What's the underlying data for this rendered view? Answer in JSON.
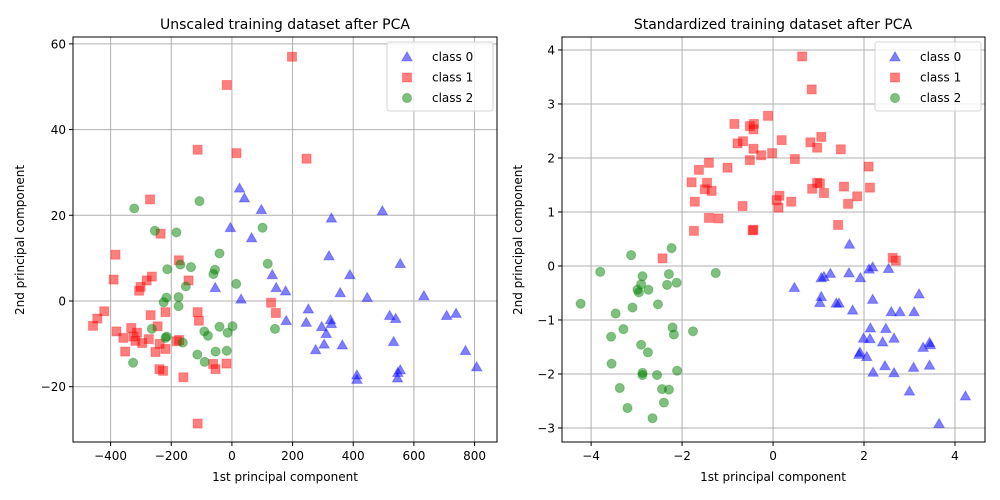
{
  "figure": {
    "legend_labels": [
      "class 0",
      "class 1",
      "class 2"
    ],
    "colors": {
      "class0": "#0000ff",
      "class1": "#ff0000",
      "class2": "#008000",
      "grid": "#b0b0b0"
    },
    "markers": {
      "class0": "triangle",
      "class1": "square",
      "class2": "circle"
    },
    "alpha": 0.5
  },
  "chart_data": [
    {
      "type": "scatter",
      "title": "Unscaled training dataset after PCA",
      "xlabel": "1st principal component",
      "ylabel": "2nd principal component",
      "xlim": [
        -524,
        874
      ],
      "ylim": [
        -32.9,
        61.6
      ],
      "xticks": [
        -400,
        -200,
        0,
        200,
        400,
        600,
        800
      ],
      "xtick_labels": [
        "−400",
        "−200",
        "0",
        "200",
        "400",
        "600",
        "800"
      ],
      "yticks": [
        -20,
        0,
        20,
        40,
        60
      ],
      "ytick_labels": [
        "−20",
        "0",
        "20",
        "40",
        "60"
      ],
      "grid": true,
      "legend": "top-right",
      "series": [
        {
          "name": "class 0",
          "points": [
            [
              25,
              26.3
            ],
            [
              41,
              24.0
            ],
            [
              97,
              21.3
            ],
            [
              -5,
              17.1
            ],
            [
              65,
              14.7
            ],
            [
              328,
              19.3
            ],
            [
              496,
              21.0
            ],
            [
              320,
              10.5
            ],
            [
              555,
              8.7
            ],
            [
              389,
              6.1
            ],
            [
              133,
              6.1
            ],
            [
              -55,
              3.1
            ],
            [
              146,
              3.1
            ],
            [
              177,
              2.3
            ],
            [
              30,
              0.4
            ],
            [
              357,
              1.9
            ],
            [
              446,
              0.8
            ],
            [
              633,
              1.2
            ],
            [
              252,
              -1.9
            ],
            [
              179,
              -4.6
            ],
            [
              245,
              -5.0
            ],
            [
              296,
              -6.0
            ],
            [
              325,
              -4.4
            ],
            [
              328,
              -5.3
            ],
            [
              311,
              -7.6
            ],
            [
              520,
              -3.4
            ],
            [
              540,
              -4.1
            ],
            [
              708,
              -3.4
            ],
            [
              739,
              -2.9
            ],
            [
              533,
              -9.5
            ],
            [
              276,
              -11.4
            ],
            [
              304,
              -10.1
            ],
            [
              364,
              -10.3
            ],
            [
              770,
              -11.6
            ],
            [
              807,
              -15.4
            ],
            [
              412,
              -17.3
            ],
            [
              412,
              -18.3
            ],
            [
              547,
              -16.7
            ],
            [
              555,
              -16.1
            ],
            [
              546,
              -18.0
            ]
          ]
        },
        {
          "name": "class 1",
          "points": [
            [
              198,
              57.0
            ],
            [
              -17,
              50.4
            ],
            [
              -113,
              35.3
            ],
            [
              15,
              34.5
            ],
            [
              246,
              33.2
            ],
            [
              -270,
              23.7
            ],
            [
              -235,
              15.7
            ],
            [
              -384,
              10.8
            ],
            [
              -175,
              9.5
            ],
            [
              -390,
              5.0
            ],
            [
              -264,
              5.7
            ],
            [
              -281,
              4.8
            ],
            [
              -143,
              4.8
            ],
            [
              -301,
              3.3
            ],
            [
              -306,
              2.4
            ],
            [
              129,
              -0.4
            ],
            [
              145,
              -2.8
            ],
            [
              -421,
              -2.4
            ],
            [
              -444,
              -4.1
            ],
            [
              -458,
              -5.8
            ],
            [
              -113,
              -2.6
            ],
            [
              -109,
              -4.6
            ],
            [
              -268,
              -3.3
            ],
            [
              -219,
              -2.6
            ],
            [
              -381,
              -7.1
            ],
            [
              -358,
              -8.6
            ],
            [
              -332,
              -6.3
            ],
            [
              -325,
              -8.3
            ],
            [
              -313,
              -7.4
            ],
            [
              -318,
              -9.3
            ],
            [
              -296,
              -9.8
            ],
            [
              -274,
              -8.9
            ],
            [
              -352,
              -11.8
            ],
            [
              -238,
              -10.0
            ],
            [
              -245,
              -5.9
            ],
            [
              -219,
              -11.2
            ],
            [
              -252,
              -11.9
            ],
            [
              -174,
              -9.1
            ],
            [
              -182,
              -9.4
            ],
            [
              -62,
              -14.7
            ],
            [
              -54,
              -15.9
            ],
            [
              -18,
              -14.6
            ],
            [
              -239,
              -15.9
            ],
            [
              -227,
              -16.3
            ],
            [
              -160,
              -17.8
            ],
            [
              -113,
              -28.6
            ]
          ]
        },
        {
          "name": "class 2",
          "points": [
            [
              -107,
              23.3
            ],
            [
              -322,
              21.6
            ],
            [
              -254,
              16.4
            ],
            [
              -183,
              16.0
            ],
            [
              -41,
              11.1
            ],
            [
              118,
              8.7
            ],
            [
              101,
              17.1
            ],
            [
              -170,
              8.5
            ],
            [
              -135,
              7.9
            ],
            [
              -213,
              7.4
            ],
            [
              -56,
              7.3
            ],
            [
              -61,
              6.3
            ],
            [
              14,
              4.0
            ],
            [
              -152,
              3.4
            ],
            [
              -176,
              0.9
            ],
            [
              -216,
              0.8
            ],
            [
              -176,
              -1.2
            ],
            [
              -225,
              -0.3
            ],
            [
              -41,
              -6.0
            ],
            [
              -91,
              -7.1
            ],
            [
              -79,
              -8.1
            ],
            [
              -14,
              -7.4
            ],
            [
              2,
              -5.9
            ],
            [
              -264,
              -6.5
            ],
            [
              -215,
              -8.3
            ],
            [
              -219,
              -8.6
            ],
            [
              -162,
              -9.7
            ],
            [
              -114,
              -12.5
            ],
            [
              -90,
              -14.2
            ],
            [
              -54,
              -11.8
            ],
            [
              -17,
              -11.6
            ],
            [
              -326,
              -14.4
            ],
            [
              142,
              -6.5
            ]
          ]
        }
      ]
    },
    {
      "type": "scatter",
      "title": "Standardized training dataset after PCA",
      "xlabel": "1st principal component",
      "ylabel": "2nd principal component",
      "xlim": [
        -4.64,
        4.66
      ],
      "ylim": [
        -3.26,
        4.24
      ],
      "xticks": [
        -4,
        -2,
        0,
        2,
        4
      ],
      "xtick_labels": [
        "−4",
        "−2",
        "0",
        "2",
        "4"
      ],
      "yticks": [
        -3,
        -2,
        -1,
        0,
        1,
        2,
        3,
        4
      ],
      "ytick_labels": [
        "−3",
        "−2",
        "−1",
        "0",
        "1",
        "2",
        "3",
        "4"
      ],
      "grid": true,
      "legend": "top-right",
      "series": [
        {
          "name": "class 0",
          "points": [
            [
              1.68,
              0.4
            ],
            [
              0.47,
              -0.4
            ],
            [
              1.06,
              -0.22
            ],
            [
              1.12,
              -0.2
            ],
            [
              1.26,
              -0.14
            ],
            [
              1.67,
              -0.13
            ],
            [
              1.92,
              -0.22
            ],
            [
              2.11,
              -0.06
            ],
            [
              2.19,
              -0.02
            ],
            [
              2.54,
              -0.05
            ],
            [
              1.06,
              -0.57
            ],
            [
              1.03,
              -0.68
            ],
            [
              1.39,
              -0.69
            ],
            [
              1.45,
              -0.69
            ],
            [
              1.75,
              -0.82
            ],
            [
              2.19,
              -0.62
            ],
            [
              2.6,
              -0.85
            ],
            [
              2.79,
              -0.85
            ],
            [
              3.1,
              -0.85
            ],
            [
              3.21,
              -0.52
            ],
            [
              2.14,
              -1.15
            ],
            [
              2.48,
              -1.16
            ],
            [
              1.99,
              -1.34
            ],
            [
              2.13,
              -1.35
            ],
            [
              2.41,
              -1.41
            ],
            [
              2.66,
              -1.34
            ],
            [
              1.91,
              -1.6
            ],
            [
              1.89,
              -1.64
            ],
            [
              2.06,
              -1.68
            ],
            [
              3.3,
              -1.51
            ],
            [
              3.44,
              -1.42
            ],
            [
              3.46,
              -1.46
            ],
            [
              2.2,
              -1.97
            ],
            [
              2.46,
              -1.85
            ],
            [
              2.66,
              -1.98
            ],
            [
              3.09,
              -1.88
            ],
            [
              3.44,
              -1.84
            ],
            [
              3.0,
              -2.32
            ],
            [
              4.23,
              -2.41
            ],
            [
              3.65,
              -2.92
            ]
          ]
        },
        {
          "name": "class 1",
          "points": [
            [
              0.64,
              3.88
            ],
            [
              0.85,
              3.27
            ],
            [
              -0.11,
              2.78
            ],
            [
              -0.85,
              2.63
            ],
            [
              -0.42,
              2.63
            ],
            [
              -0.43,
              2.53
            ],
            [
              -0.51,
              2.59
            ],
            [
              0.19,
              2.33
            ],
            [
              0.82,
              2.29
            ],
            [
              1.06,
              2.39
            ],
            [
              -0.78,
              2.27
            ],
            [
              -0.66,
              2.31
            ],
            [
              -0.43,
              2.17
            ],
            [
              -0.26,
              2.05
            ],
            [
              -0.02,
              2.09
            ],
            [
              0.48,
              1.98
            ],
            [
              0.97,
              2.19
            ],
            [
              1.49,
              2.16
            ],
            [
              2.1,
              1.84
            ],
            [
              -0.51,
              1.96
            ],
            [
              -1.0,
              1.82
            ],
            [
              -1.41,
              1.91
            ],
            [
              -1.63,
              1.78
            ],
            [
              -1.79,
              1.55
            ],
            [
              -1.45,
              1.54
            ],
            [
              -1.5,
              1.42
            ],
            [
              -1.35,
              1.39
            ],
            [
              -1.72,
              1.19
            ],
            [
              -0.67,
              1.11
            ],
            [
              0.08,
              1.22
            ],
            [
              0.14,
              1.3
            ],
            [
              0.4,
              1.19
            ],
            [
              0.12,
              1.08
            ],
            [
              0.86,
              1.43
            ],
            [
              0.97,
              1.54
            ],
            [
              1.03,
              1.53
            ],
            [
              1.12,
              1.35
            ],
            [
              1.56,
              1.47
            ],
            [
              1.65,
              1.15
            ],
            [
              1.85,
              1.29
            ],
            [
              2.13,
              1.45
            ],
            [
              -1.41,
              0.89
            ],
            [
              -1.2,
              0.88
            ],
            [
              -1.74,
              0.65
            ],
            [
              1.43,
              0.76
            ],
            [
              -0.45,
              0.66
            ],
            [
              -0.43,
              0.67
            ],
            [
              -2.43,
              0.14
            ],
            [
              2.63,
              0.15
            ],
            [
              2.7,
              0.1
            ]
          ]
        },
        {
          "name": "class 2",
          "points": [
            [
              -2.23,
              0.33
            ],
            [
              -3.12,
              0.2
            ],
            [
              -3.8,
              -0.11
            ],
            [
              -1.26,
              -0.13
            ],
            [
              -2.87,
              -0.19
            ],
            [
              -2.29,
              -0.15
            ],
            [
              -2.33,
              -0.35
            ],
            [
              -2.12,
              -0.31
            ],
            [
              -2.9,
              -0.34
            ],
            [
              -2.98,
              -0.44
            ],
            [
              -2.95,
              -0.49
            ],
            [
              -2.74,
              -0.44
            ],
            [
              -2.53,
              -0.71
            ],
            [
              -4.23,
              -0.7
            ],
            [
              -3.09,
              -0.77
            ],
            [
              -3.46,
              -0.88
            ],
            [
              -2.21,
              -1.14
            ],
            [
              -2.18,
              -1.27
            ],
            [
              -1.76,
              -1.21
            ],
            [
              -3.29,
              -1.17
            ],
            [
              -3.56,
              -1.31
            ],
            [
              -2.9,
              -1.46
            ],
            [
              -2.75,
              -1.6
            ],
            [
              -3.55,
              -1.81
            ],
            [
              -2.87,
              -1.98
            ],
            [
              -2.87,
              -2.02
            ],
            [
              -2.55,
              -2.02
            ],
            [
              -2.11,
              -1.94
            ],
            [
              -3.37,
              -2.26
            ],
            [
              -2.44,
              -2.28
            ],
            [
              -2.29,
              -2.29
            ],
            [
              -2.4,
              -2.53
            ],
            [
              -3.2,
              -2.63
            ],
            [
              -2.65,
              -2.82
            ]
          ]
        }
      ]
    }
  ]
}
